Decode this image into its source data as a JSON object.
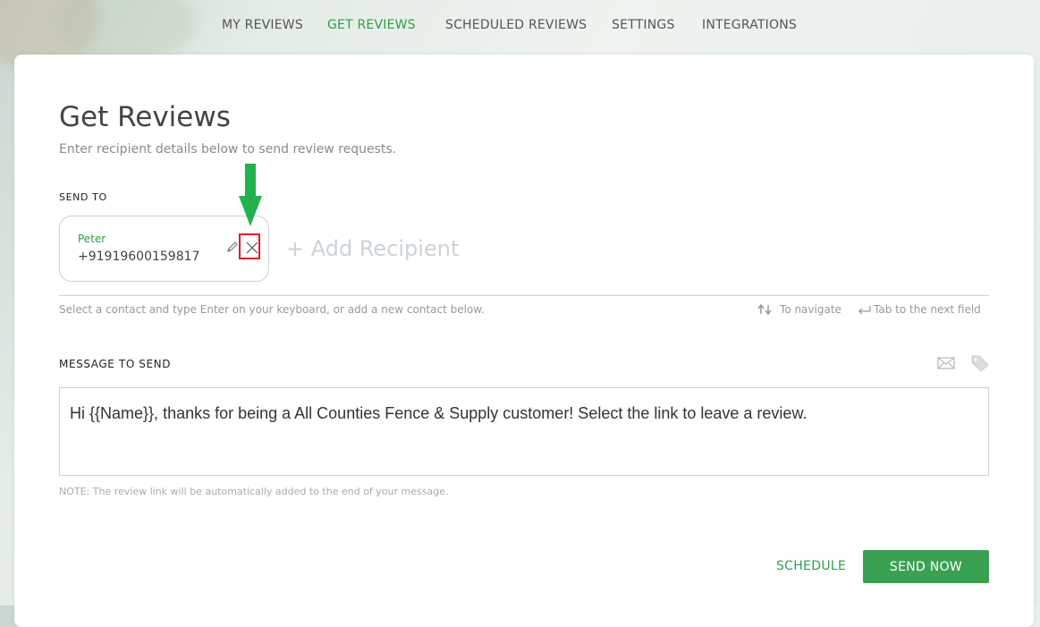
{
  "nav": {
    "items": [
      {
        "label": "MY REVIEWS",
        "active": false
      },
      {
        "label": "GET REVIEWS",
        "active": true
      },
      {
        "label": "SCHEDULED REVIEWS",
        "active": false
      },
      {
        "label": "SETTINGS",
        "active": false
      },
      {
        "label": "INTEGRATIONS",
        "active": false
      }
    ]
  },
  "page": {
    "title": "Get Reviews",
    "subtitle": "Enter recipient details below to send review requests."
  },
  "send_to": {
    "label": "SEND TO",
    "recipient": {
      "name": "Peter",
      "phone": "+91919600159817"
    },
    "add_recipient": "+ Add Recipient",
    "hint": "Select a contact and type Enter on your keyboard, or add a new contact below.",
    "navigate_hint": "To navigate",
    "tab_hint": "Tab to the next field"
  },
  "message": {
    "label": "MESSAGE TO SEND",
    "text": "Hi {{Name}}, thanks for being a All Counties Fence & Supply customer! Select the link to leave a review.",
    "note": "NOTE: The review link will be automatically added to the end of your message."
  },
  "actions": {
    "schedule": "SCHEDULE",
    "send_now": "SEND NOW"
  },
  "colors": {
    "accent": "#2e9e4a",
    "button": "#3aa152",
    "annotation_arrow": "#22b14c",
    "annotation_box": "#e11c24"
  }
}
